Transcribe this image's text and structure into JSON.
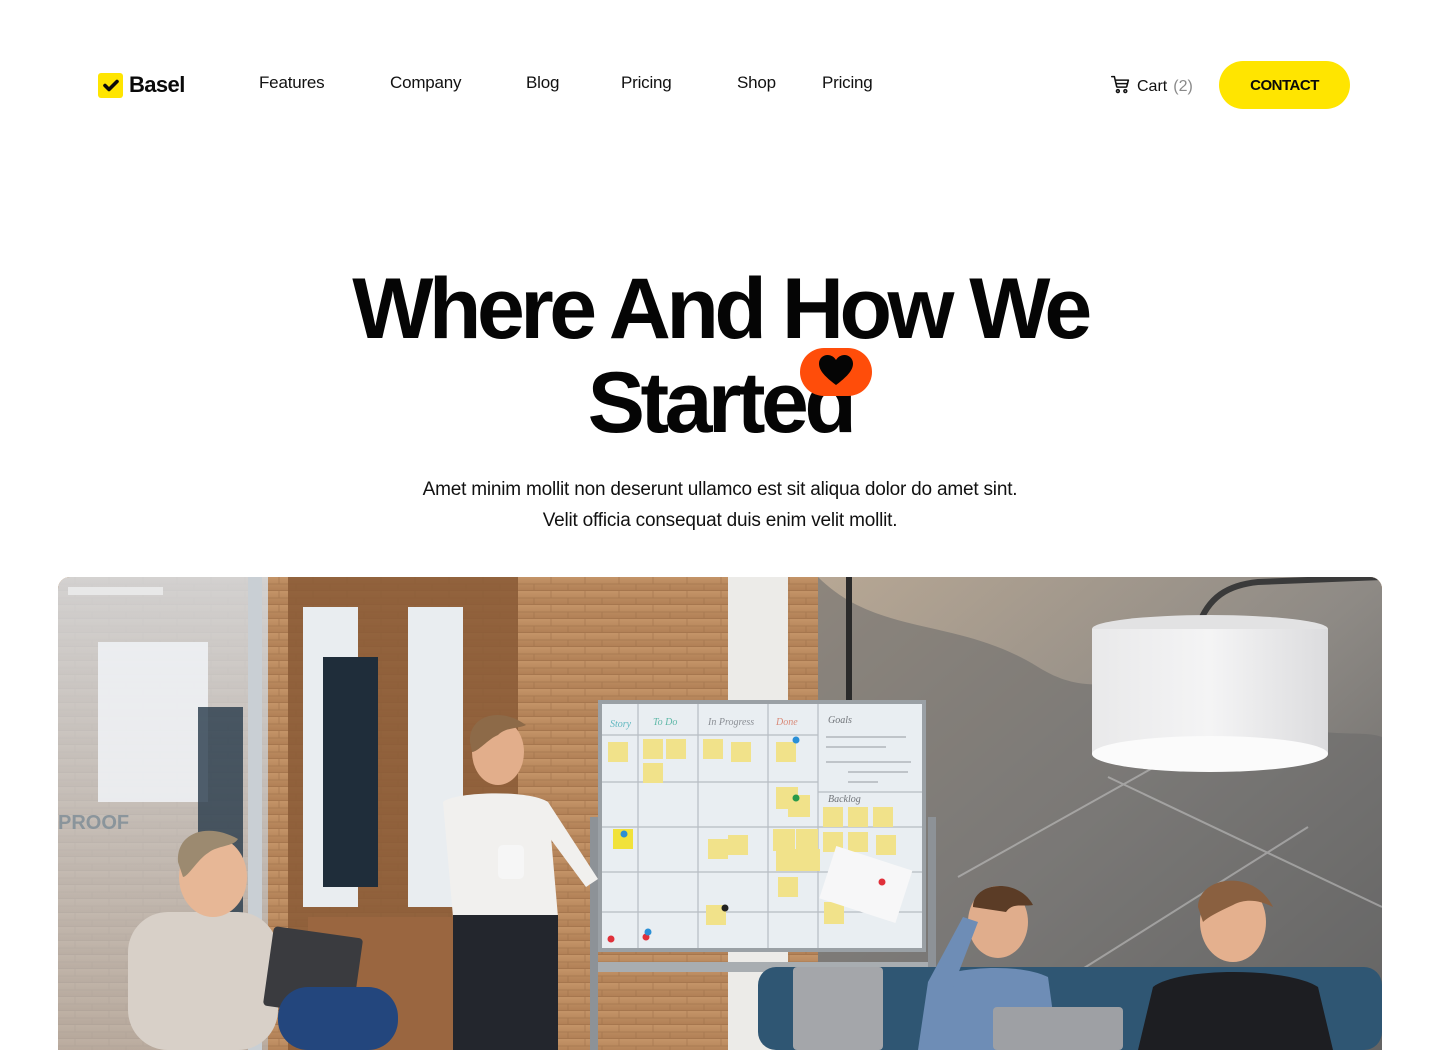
{
  "brand": {
    "name": "Basel",
    "logo_icon": "checkmark-icon",
    "accent_color": "#ffe500"
  },
  "nav": {
    "items": [
      {
        "label": "Features"
      },
      {
        "label": "Company"
      },
      {
        "label": "Blog"
      },
      {
        "label": "Pricing"
      },
      {
        "label": "Shop"
      },
      {
        "label": "Pricing"
      }
    ]
  },
  "cart": {
    "icon": "shopping-cart-icon",
    "label": "Cart",
    "count": "(2)"
  },
  "contact_button": {
    "label": "CONTACT"
  },
  "hero": {
    "title_line_1": "Where And How We",
    "title_line_2": "Started",
    "badge_icon": "heart-icon",
    "badge_color": "#ff4d0a",
    "subtitle_line_1": "Amet minim mollit non deserunt ullamco est sit aliqua dolor do amet sint.",
    "subtitle_line_2": "Velit officia consequat duis enim velit mollit."
  },
  "photo": {
    "alt": "Team meeting in an office with a whiteboard of sticky notes",
    "whiteboard_columns": [
      "Story",
      "To Do",
      "In Progress",
      "Done",
      "Goals"
    ],
    "whiteboard_backlog_label": "Backlog"
  }
}
